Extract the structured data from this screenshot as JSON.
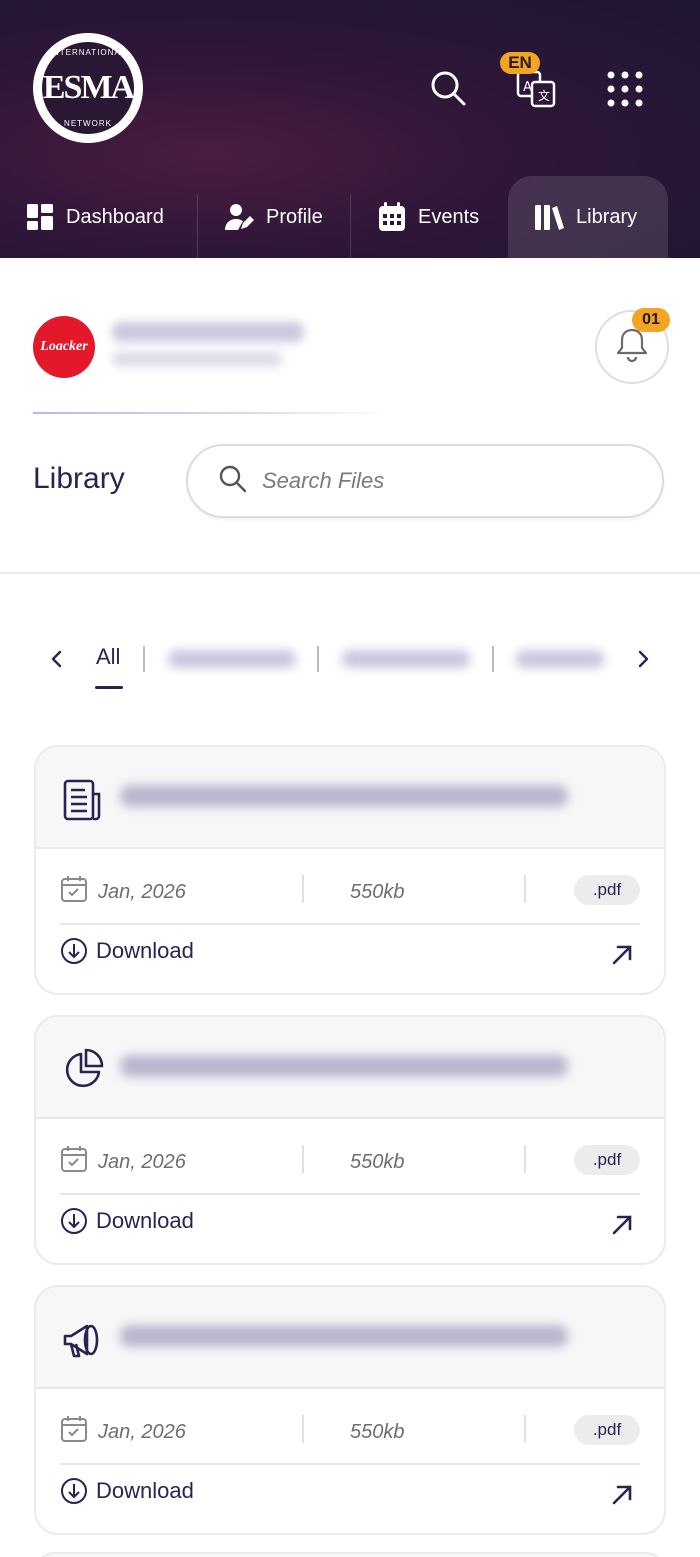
{
  "header": {
    "logo_text": "ESMA",
    "logo_ring_top": "INTERNATIONAL",
    "logo_ring_bottom": "NETWORK",
    "language_badge": "EN",
    "icons": [
      "search-icon",
      "translate-icon",
      "apps-grid-icon"
    ]
  },
  "nav": {
    "items": [
      {
        "label": "Dashboard",
        "icon": "dashboard-icon"
      },
      {
        "label": "Profile",
        "icon": "profile-edit-icon"
      },
      {
        "label": "Events",
        "icon": "calendar-icon"
      },
      {
        "label": "Library",
        "icon": "library-books-icon",
        "active": true
      }
    ]
  },
  "user": {
    "company_logo_text": "Loacker",
    "notification_count": "01"
  },
  "library": {
    "title": "Library",
    "search_placeholder": "Search Files"
  },
  "tabs": {
    "active": "All",
    "items": [
      "All"
    ]
  },
  "files": [
    {
      "icon": "document-icon",
      "date": "Jan, 2026",
      "size": "550kb",
      "type": ".pdf",
      "download_label": "Download"
    },
    {
      "icon": "pie-chart-icon",
      "date": "Jan, 2026",
      "size": "550kb",
      "type": ".pdf",
      "download_label": "Download"
    },
    {
      "icon": "megaphone-icon",
      "date": "Jan, 2026",
      "size": "550kb",
      "type": ".pdf",
      "download_label": "Download"
    }
  ],
  "colors": {
    "header_bg": "#2e1638",
    "accent_badge": "#f3a521",
    "primary_text": "#2a2352",
    "brand_red": "#e3182b"
  }
}
